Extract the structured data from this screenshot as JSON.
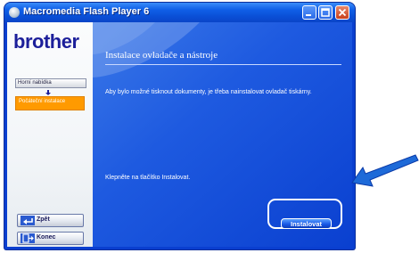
{
  "window": {
    "title": "Macromedia Flash Player 6"
  },
  "sidebar": {
    "logo": "brother",
    "nav": {
      "home_label": "Horní nabídka",
      "current_label": "Počáteční instalace"
    },
    "back_label": "Zpět",
    "exit_label": "Konec"
  },
  "main": {
    "title": "Instalace ovladače a nástroje",
    "description": "Aby bylo možné tisknout dokumenty, je třeba nainstalovat ovladač tiskárny.",
    "instruction": "Klepněte na tlačítko Instalovat.",
    "install_label": "Instalovat"
  },
  "colors": {
    "titlebar": "#0a4fd6",
    "content_blue": "#1e5ae0",
    "current_nav": "#ff9a00",
    "pointer_arrow": "#1e6ad8"
  }
}
